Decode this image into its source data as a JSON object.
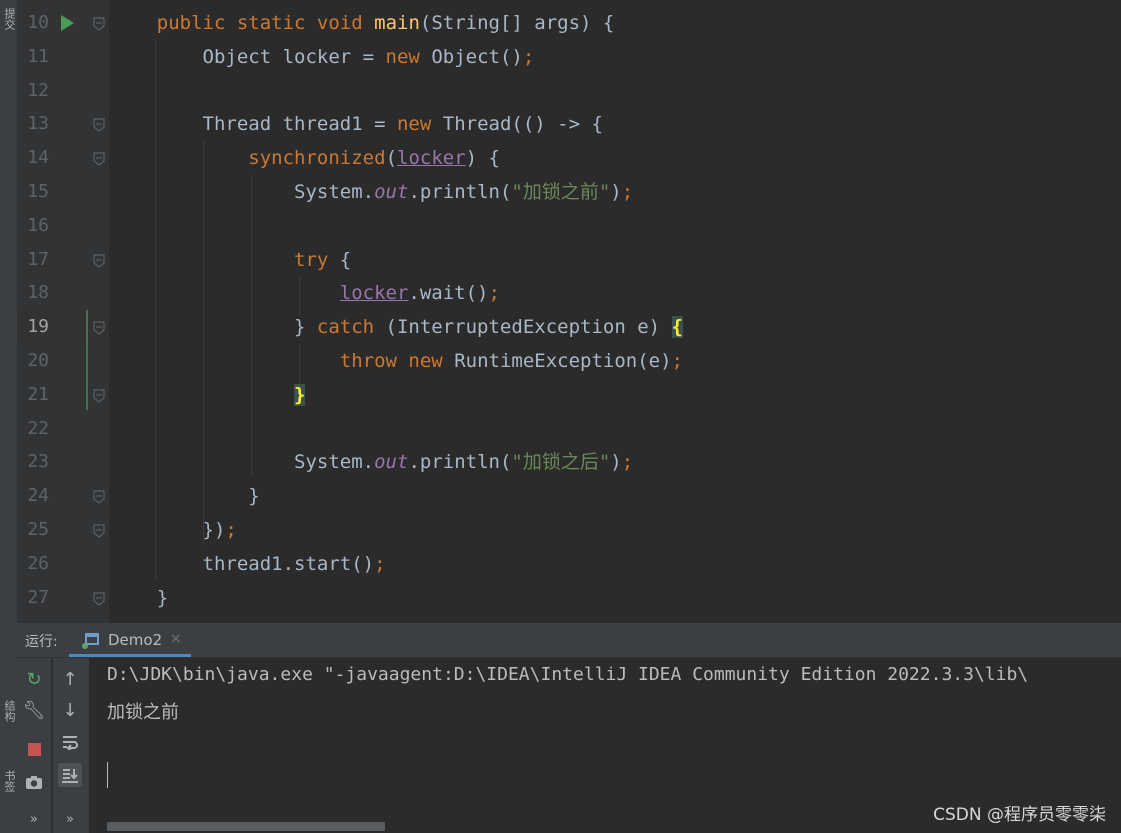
{
  "sidebar": {
    "commit": "提交",
    "structure": "结构",
    "bookmarks": "书签"
  },
  "code_lines": [
    {
      "num": "10",
      "tokens": [
        [
          "    ",
          "plain"
        ],
        [
          "public ",
          "kw"
        ],
        [
          "static ",
          "kw"
        ],
        [
          "void ",
          "kw"
        ],
        [
          "main",
          "fn"
        ],
        [
          "(String[] args) {",
          "plain"
        ]
      ]
    },
    {
      "num": "11",
      "tokens": [
        [
          "        Object locker = ",
          "plain"
        ],
        [
          "new ",
          "kw"
        ],
        [
          "Object()",
          "plain"
        ],
        [
          ";",
          "kw"
        ]
      ]
    },
    {
      "num": "12",
      "tokens": []
    },
    {
      "num": "13",
      "tokens": [
        [
          "        Thread thread1 = ",
          "plain"
        ],
        [
          "new ",
          "kw"
        ],
        [
          "Thread(() -> {",
          "plain"
        ]
      ]
    },
    {
      "num": "14",
      "tokens": [
        [
          "            ",
          "plain"
        ],
        [
          "synchronized",
          "kw"
        ],
        [
          "(",
          "plain"
        ],
        [
          "locker",
          "fld"
        ],
        [
          ") {",
          "plain"
        ]
      ]
    },
    {
      "num": "15",
      "tokens": [
        [
          "                System.",
          "plain"
        ],
        [
          "out",
          "ital"
        ],
        [
          ".println(",
          "plain"
        ],
        [
          "\"加锁之前\"",
          "str"
        ],
        [
          ")",
          "plain"
        ],
        [
          ";",
          "kw"
        ]
      ]
    },
    {
      "num": "16",
      "tokens": []
    },
    {
      "num": "17",
      "tokens": [
        [
          "                ",
          "plain"
        ],
        [
          "try ",
          "kw"
        ],
        [
          "{",
          "plain"
        ]
      ]
    },
    {
      "num": "18",
      "tokens": [
        [
          "                    ",
          "plain"
        ],
        [
          "locker",
          "fld"
        ],
        [
          ".wait()",
          "plain"
        ],
        [
          ";",
          "kw"
        ]
      ]
    },
    {
      "num": "19",
      "tokens": [
        [
          "                } ",
          "plain"
        ],
        [
          "catch ",
          "kw"
        ],
        [
          "(InterruptedException e) ",
          "plain"
        ],
        [
          "{",
          "hl"
        ]
      ]
    },
    {
      "num": "20",
      "tokens": [
        [
          "                    ",
          "plain"
        ],
        [
          "throw ",
          "kw"
        ],
        [
          "new ",
          "kw"
        ],
        [
          "RuntimeException(e)",
          "plain"
        ],
        [
          ";",
          "kw"
        ]
      ]
    },
    {
      "num": "21",
      "tokens": [
        [
          "                ",
          "plain"
        ],
        [
          "}",
          "hl"
        ]
      ]
    },
    {
      "num": "22",
      "tokens": []
    },
    {
      "num": "23",
      "tokens": [
        [
          "                System.",
          "plain"
        ],
        [
          "out",
          "ital"
        ],
        [
          ".println(",
          "plain"
        ],
        [
          "\"加锁之后\"",
          "str"
        ],
        [
          ")",
          "plain"
        ],
        [
          ";",
          "kw"
        ]
      ]
    },
    {
      "num": "24",
      "tokens": [
        [
          "            }",
          "plain"
        ]
      ]
    },
    {
      "num": "25",
      "tokens": [
        [
          "        })",
          "plain"
        ],
        [
          ";",
          "kw"
        ]
      ]
    },
    {
      "num": "26",
      "tokens": [
        [
          "        thread1.start()",
          "plain"
        ],
        [
          ";",
          "kw"
        ]
      ]
    },
    {
      "num": "27",
      "tokens": [
        [
          "    }",
          "plain"
        ]
      ]
    }
  ],
  "current_line": "19",
  "run_panel": {
    "label": "运行:",
    "tab_name": "Demo2",
    "tab_close": "×",
    "console_lines": [
      "D:\\JDK\\bin\\java.exe \"-javaagent:D:\\IDEA\\IntelliJ IDEA Community Edition 2022.3.3\\lib\\",
      "加锁之前"
    ],
    "more_tools": "»"
  },
  "watermark": "CSDN @程序员零零柒",
  "colors": {
    "keyword": "#cc7832",
    "method": "#ffc66d",
    "string": "#6a8759",
    "field": "#9876aa",
    "text": "#a9b7c6",
    "run_green": "#499c54",
    "stop_red": "#c75450"
  }
}
